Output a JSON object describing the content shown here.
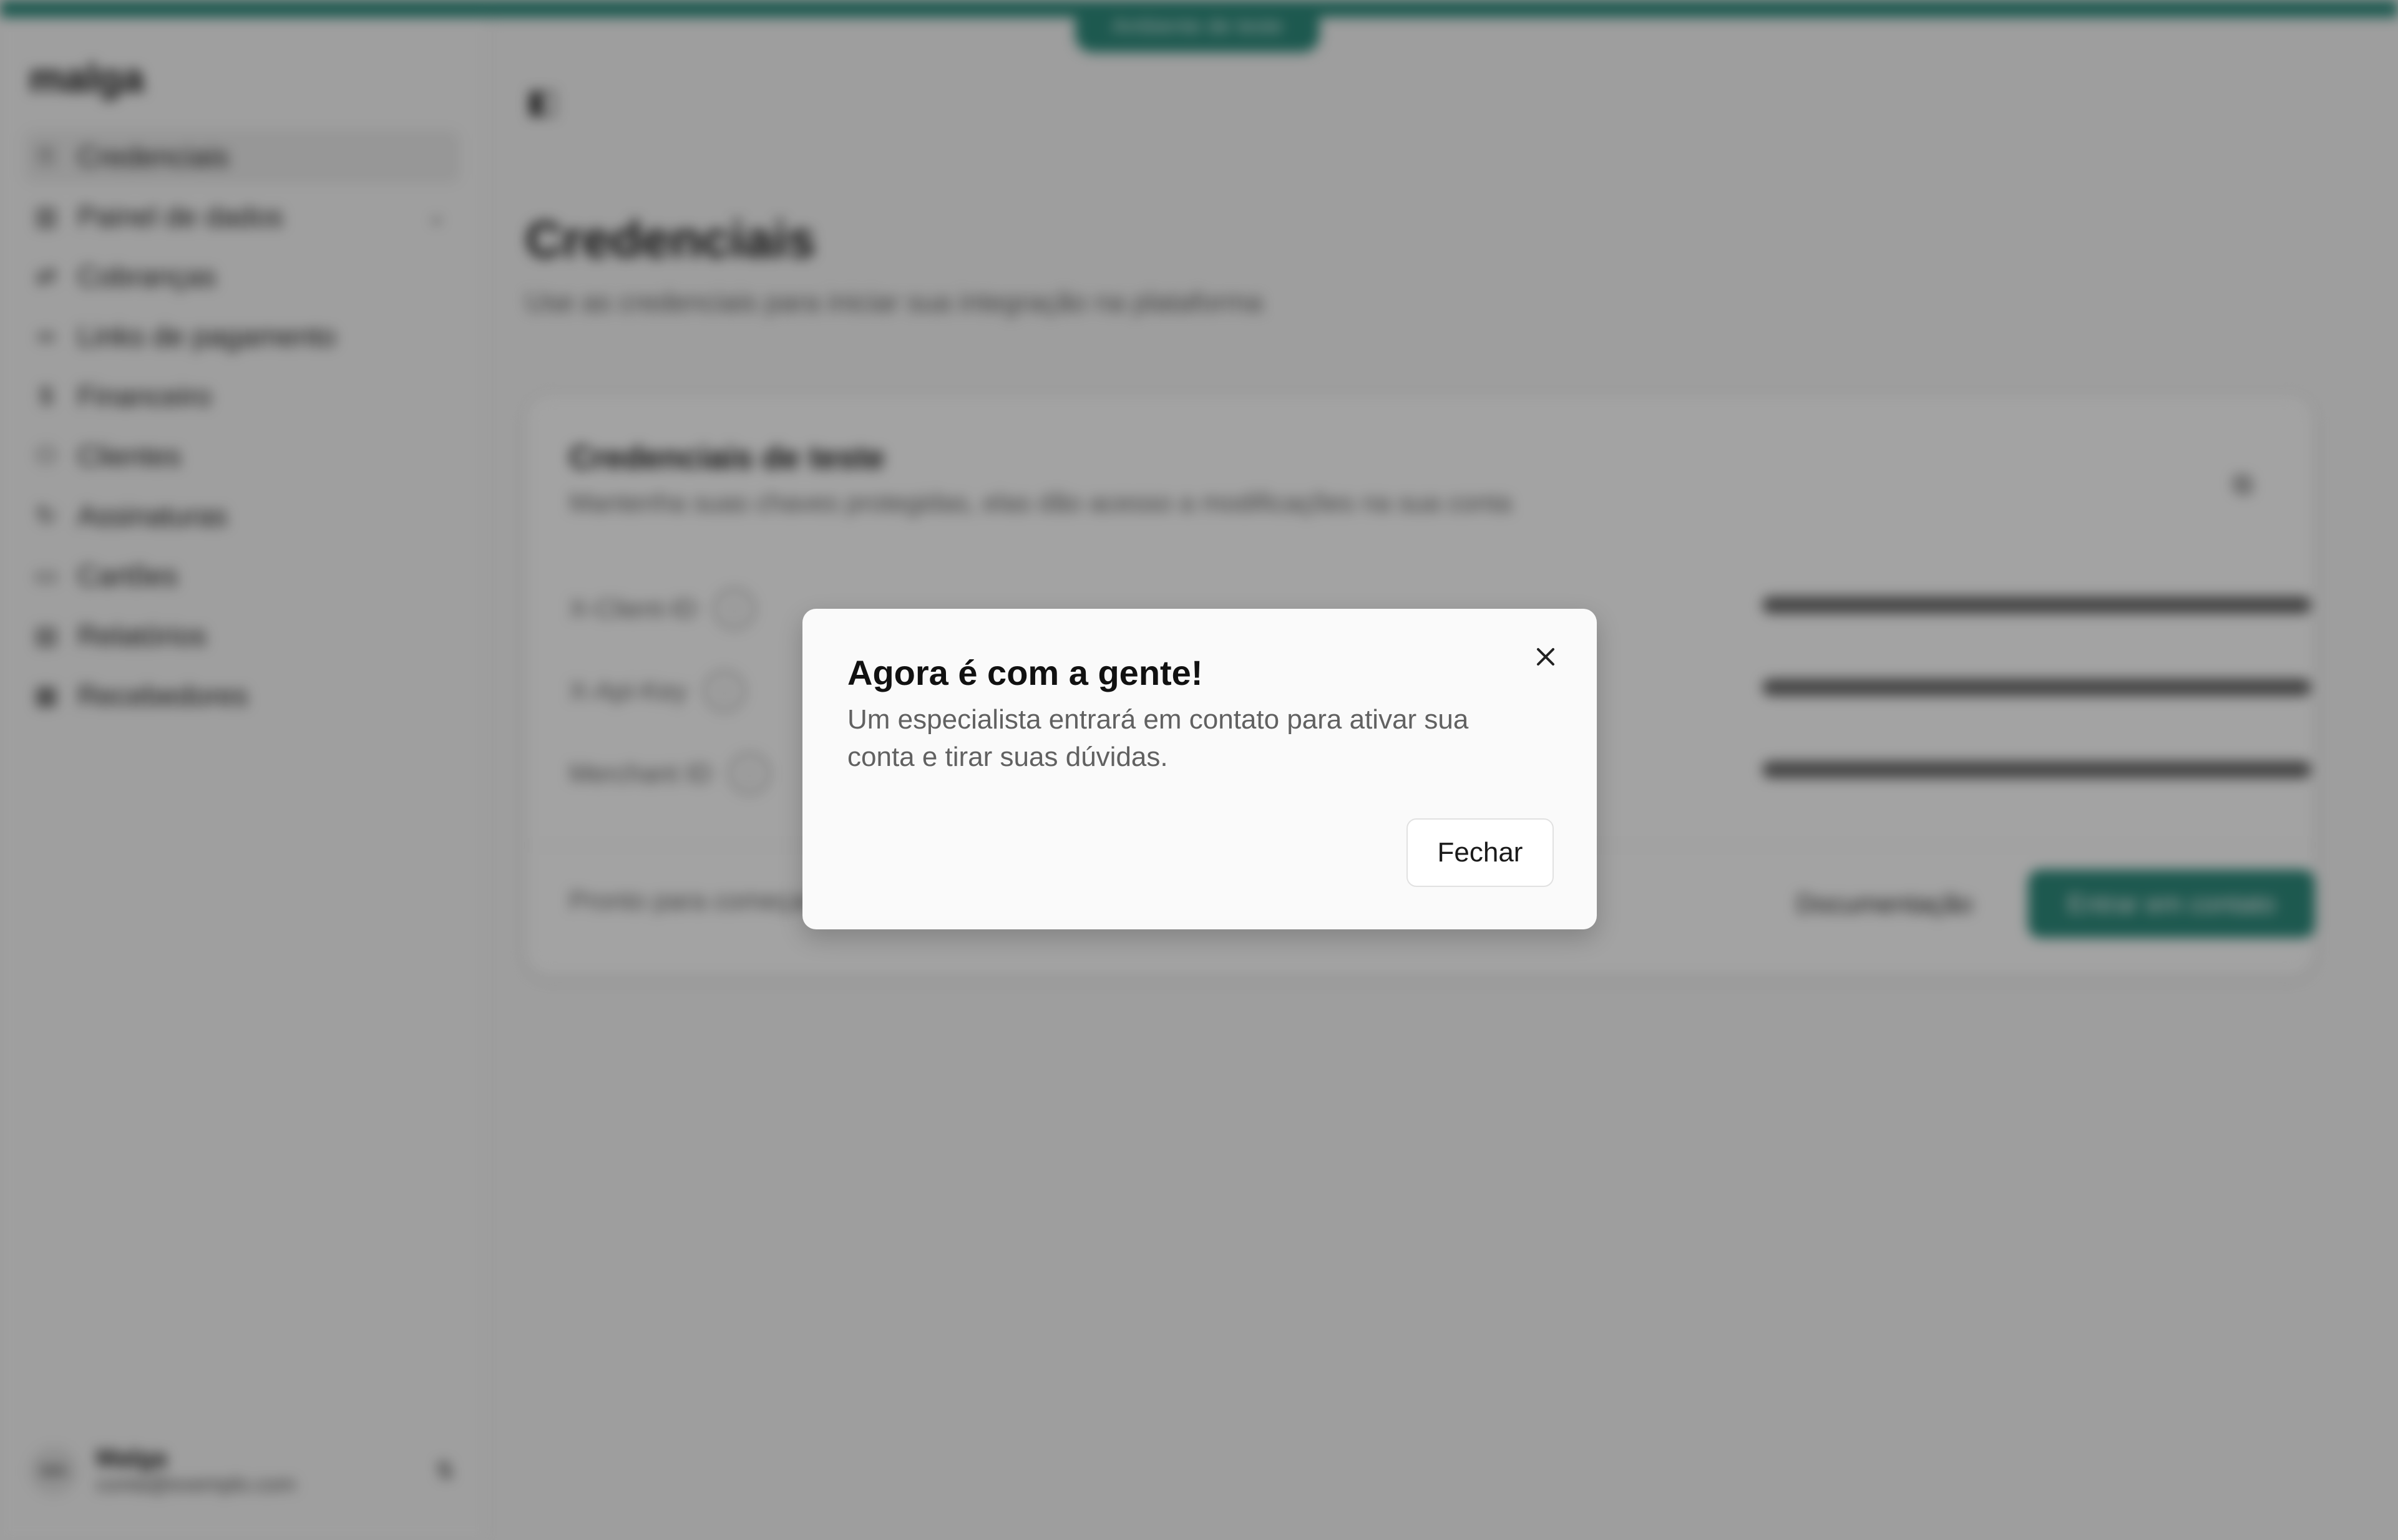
{
  "colors": {
    "accent": "#2e8b7c"
  },
  "top_banner": {
    "label": "Ambiente de teste"
  },
  "sidebar": {
    "logo": "malga",
    "items": [
      {
        "label": "Credenciais",
        "icon": "key-icon",
        "active": true
      },
      {
        "label": "Painel de dados",
        "icon": "chart-icon",
        "has_caret": true
      },
      {
        "label": "Cobranças",
        "icon": "arrows-icon"
      },
      {
        "label": "Links de pagamento",
        "icon": "link-icon"
      },
      {
        "label": "Financeiro",
        "icon": "dollar-icon"
      },
      {
        "label": "Clientes",
        "icon": "users-icon"
      },
      {
        "label": "Assinaturas",
        "icon": "repeat-icon"
      },
      {
        "label": "Cartões",
        "icon": "card-icon"
      },
      {
        "label": "Relatórios",
        "icon": "report-icon"
      },
      {
        "label": "Recebedores",
        "icon": "building-icon"
      }
    ],
    "user": {
      "initials": "MA",
      "name": "Malga",
      "email": "conta@exemplo.com"
    }
  },
  "main": {
    "title": "Credenciais",
    "subtitle": "Use as credenciais para iniciar sua integração na plataforma",
    "card": {
      "title": "Credenciais de teste",
      "description": "Mantenha suas chaves protegidas, elas dão acesso a modificações na sua conta",
      "fields": [
        {
          "label": "X-Client-ID"
        },
        {
          "label": "X-Api-Key"
        },
        {
          "label": "Merchant ID"
        }
      ],
      "footer_text": "Pronto para começar?",
      "secondary_button": "Documentação",
      "primary_button": "Entrar em contato"
    }
  },
  "modal": {
    "title": "Agora é com a gente!",
    "description": "Um especialista entrará em contato para ativar sua conta e tirar suas dúvidas.",
    "button_label": "Fechar",
    "close_icon": "close-icon"
  }
}
